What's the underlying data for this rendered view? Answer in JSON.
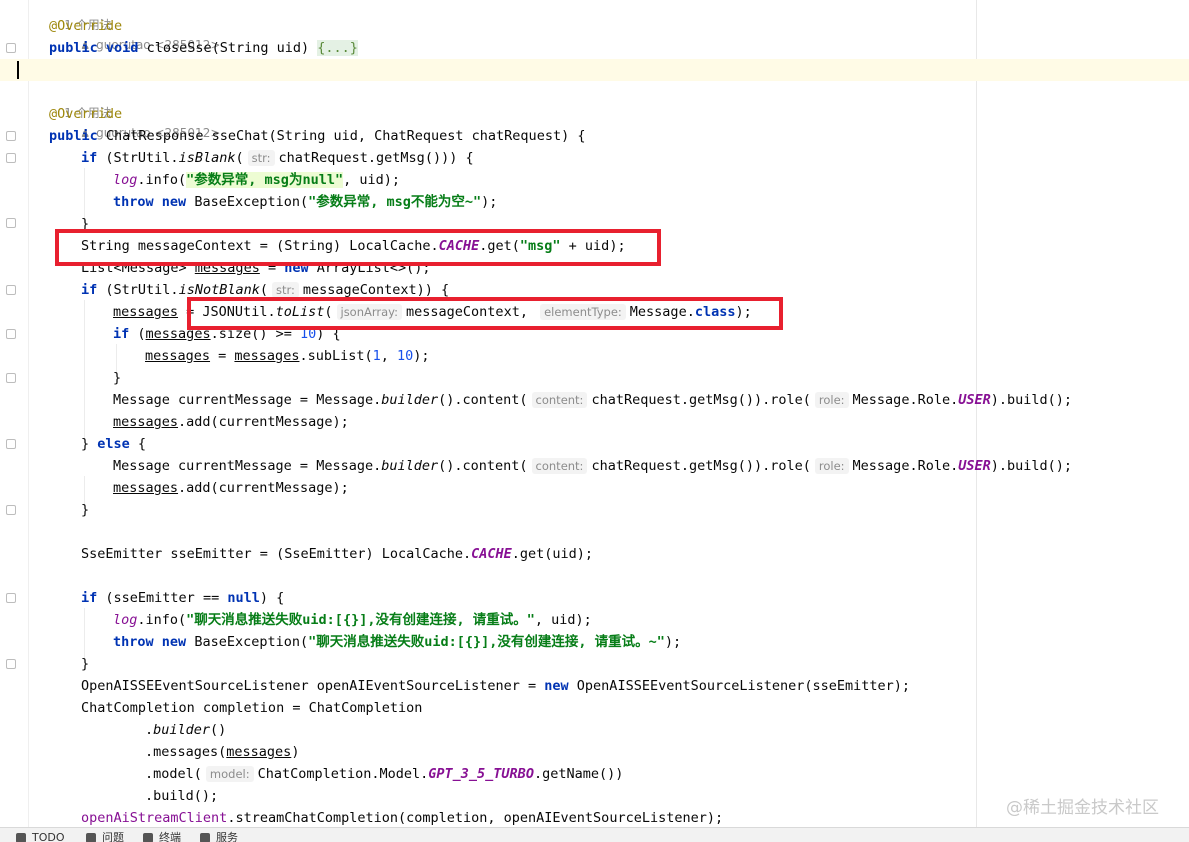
{
  "hints": {
    "usage1": "1 个用法",
    "author1": "guorutao <285012>",
    "usage2": "1 个用法",
    "author2": "guorutao <285012>"
  },
  "code": {
    "override": "@Override",
    "public": "public",
    "void": "void",
    "close_sig": "closeSse(String uid)",
    "folded": "{...}",
    "ret_type": "ChatResponse sseChat(String uid, ChatRequest chatRequest) {",
    "if": "if",
    "strutil_open": "(StrUtil.",
    "isBlank": "isBlank",
    "paren": "(",
    "hint_str": "str:",
    "blank_arg": "chatRequest.getMsg())) {",
    "log": "log",
    "info_open": ".info(",
    "err_msg1": "\"参数异常, msg为null\"",
    "info_tail": ", uid);",
    "throw": "throw",
    "new": "new",
    "be_open": "BaseException(",
    "err_msg2": "\"参数异常, msg不能为空~\"",
    "close_paren": ");",
    "close_brace": "}",
    "ctx_a": "String messageContext = (String) LocalCache.",
    "cache": "CACHE",
    "ctx_b": ".get(",
    "str_msg": "\"msg\"",
    "ctx_c": " + uid);",
    "list_a": "List<Message> ",
    "messages": "messages",
    "list_b": " = ",
    "list_c": " ArrayList<>();",
    "isNotBlank": "isNotBlank",
    "notblank_arg": "messageContext)) {",
    "assign_eq": " = ",
    "json_a": "JSONUtil.",
    "toList": "toList",
    "hint_json": "jsonArray:",
    "json_b": "messageContext, ",
    "hint_elem": "elementType:",
    "json_c": "Message.",
    "class": "class",
    "size_b": ".size() >= ",
    "ten": "10",
    "size_c": ") {",
    "sub_b": ".subList(",
    "one": "1",
    "comma": ", ",
    "msgc_a": "Message currentMessage = Message.",
    "builder": "builder",
    "msgc_b": "().content(",
    "hint_content": "content:",
    "msgc_c": "chatRequest.getMsg()).role(",
    "hint_role": "role:",
    "msgc_d": "Message.Role.",
    "user": "USER",
    "msgc_e": ").build();",
    "add_b": ".add(currentMessage);",
    "else_a": "} ",
    "else": "else",
    "else_b": " {",
    "sse_a": "SseEmitter sseEmitter = (SseEmitter) LocalCache.",
    "sse_b": ".get(uid);",
    "if_null_a": "(sseEmitter == ",
    "null": "null",
    "if_null_b": ") {",
    "chat_err1": "\"聊天消息推送失败uid:[{}],没有创建连接, 请重试。\"",
    "chat_err2": "\"聊天消息推送失败uid:[{}],没有创建连接, 请重试。~\"",
    "listener_a": "OpenAISSEEventSourceListener openAIEventSourceListener = ",
    "listener_b": " OpenAISSEEventSourceListener(sseEmitter);",
    "comp_a": "ChatCompletion completion = ChatCompletion",
    "dot": ".",
    "builder_call": "()",
    "messages_call_a": ".messages(",
    "messages_call_b": ")",
    "model_a": ".model(",
    "hint_model": "model:",
    "model_b": "ChatCompletion.Model.",
    "gpt": "GPT_3_5_TURBO",
    "model_c": ".getName())",
    "build": ".build();",
    "client": "openAiStreamClient",
    "stream_b": ".streamChatCompletion(completion, openAIEventSourceListener);"
  },
  "watermark": "@稀土掘金技术社区",
  "statusbar": {
    "todo": "TODO",
    "problems": "问题",
    "build": "终端",
    "services": "服务"
  }
}
